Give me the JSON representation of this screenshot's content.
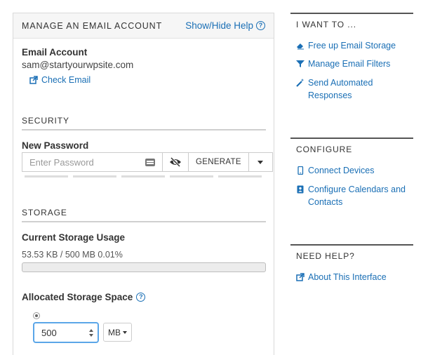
{
  "main": {
    "title": "MANAGE AN EMAIL ACCOUNT",
    "help_link": "Show/Hide Help",
    "email_account_label": "Email Account",
    "email_address": "sam@startyourwpsite.com",
    "check_email_link": "Check Email",
    "security_heading": "SECURITY",
    "new_password_label": "New Password",
    "password_placeholder": "Enter Password",
    "generate_label": "GENERATE",
    "storage_heading": "STORAGE",
    "current_usage_label": "Current Storage Usage",
    "usage_text": "53.53 KB / 500 MB 0.01%",
    "usage_percent": 0.01,
    "allocated_label": "Allocated Storage Space",
    "allocated_value": "500",
    "unit": "MB"
  },
  "sidebar": {
    "want_heading": "I WANT TO ...",
    "want_links": [
      "Free up Email Storage",
      "Manage Email Filters",
      "Send Automated Responses"
    ],
    "configure_heading": "CONFIGURE",
    "configure_links": [
      "Connect Devices",
      "Configure Calendars and Contacts"
    ],
    "help_heading": "NEED HELP?",
    "help_links": [
      "About This Interface"
    ]
  },
  "icons": {
    "external_link": "external-link-icon",
    "question": "question-circle-icon",
    "eraser": "eraser-icon",
    "filter": "filter-icon",
    "magic": "magic-wand-icon",
    "device": "mobile-device-icon",
    "contacts": "contacts-book-icon",
    "eye_slash": "eye-slash-icon",
    "keyboard": "keyboard-icon"
  },
  "colors": {
    "link": "#1a6fb5",
    "accent": "#5ba6e8",
    "header_bg": "#f6f6f6"
  }
}
